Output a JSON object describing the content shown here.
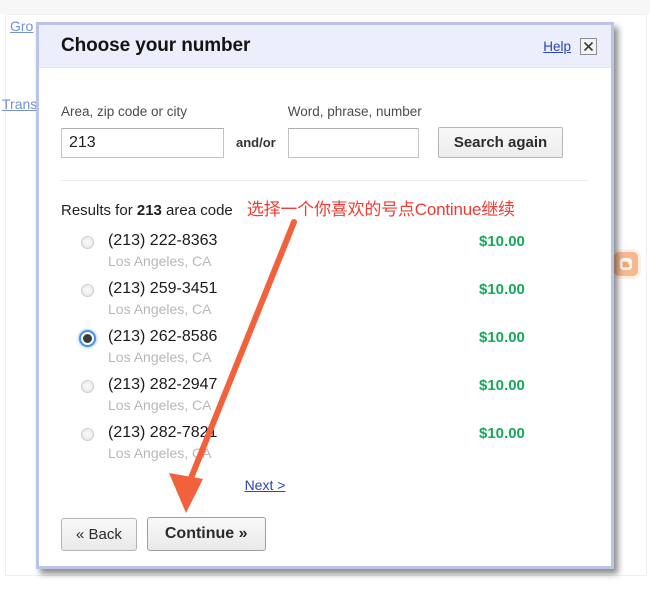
{
  "background": {
    "links": [
      {
        "name": "groups-link",
        "label": "Gro"
      },
      {
        "name": "transfer-link",
        "label": "Trans"
      }
    ],
    "blogger_icon": "blogger-icon"
  },
  "dialog": {
    "title": "Choose your number",
    "help_label": "Help",
    "close_icon": "close-icon",
    "search": {
      "area_label": "Area, zip code or city",
      "area_value": "213",
      "area_placeholder": "",
      "andor_label": "and/or",
      "word_label": "Word, phrase, number",
      "word_value": "",
      "word_placeholder": "",
      "search_again_label": "Search again"
    },
    "results": {
      "prefix": "Results for ",
      "query": "213",
      "suffix": " area code",
      "annotation": "选择一个你喜欢的号点Continue继续",
      "annotation_color": "#ef3b34",
      "next_label": "Next >",
      "items": [
        {
          "number": "(213) 222-8363",
          "city": "Los Angeles, CA",
          "price": "$10.00",
          "selected": false
        },
        {
          "number": "(213) 259-3451",
          "city": "Los Angeles, CA",
          "price": "$10.00",
          "selected": false
        },
        {
          "number": "(213) 262-8586",
          "city": "Los Angeles, CA",
          "price": "$10.00",
          "selected": true
        },
        {
          "number": "(213) 282-2947",
          "city": "Los Angeles, CA",
          "price": "$10.00",
          "selected": false
        },
        {
          "number": "(213) 282-7821",
          "city": "Los Angeles, CA",
          "price": "$10.00",
          "selected": false
        }
      ]
    },
    "footer": {
      "back_label": "« Back",
      "continue_label": "Continue »"
    }
  },
  "colors": {
    "price_green": "#18a957",
    "link_blue": "#2b44b8",
    "annotation_red": "#ef3b34",
    "dialog_border": "#b9c4e8",
    "titlebar_bg": "#eceffb"
  }
}
